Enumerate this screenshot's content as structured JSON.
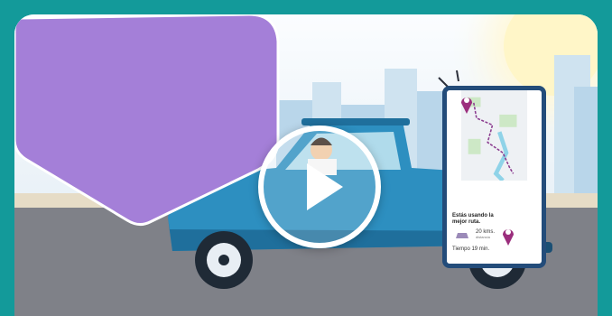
{
  "video": {
    "play_icon": "play-icon",
    "accent_teal": "#139a9a",
    "card_color": "#a07ed6"
  },
  "phone": {
    "message": "Estás usando la mejor ruta.",
    "distance": "20 kms.",
    "distance_sub": "distancia",
    "time": "Tiempo 19 min."
  }
}
